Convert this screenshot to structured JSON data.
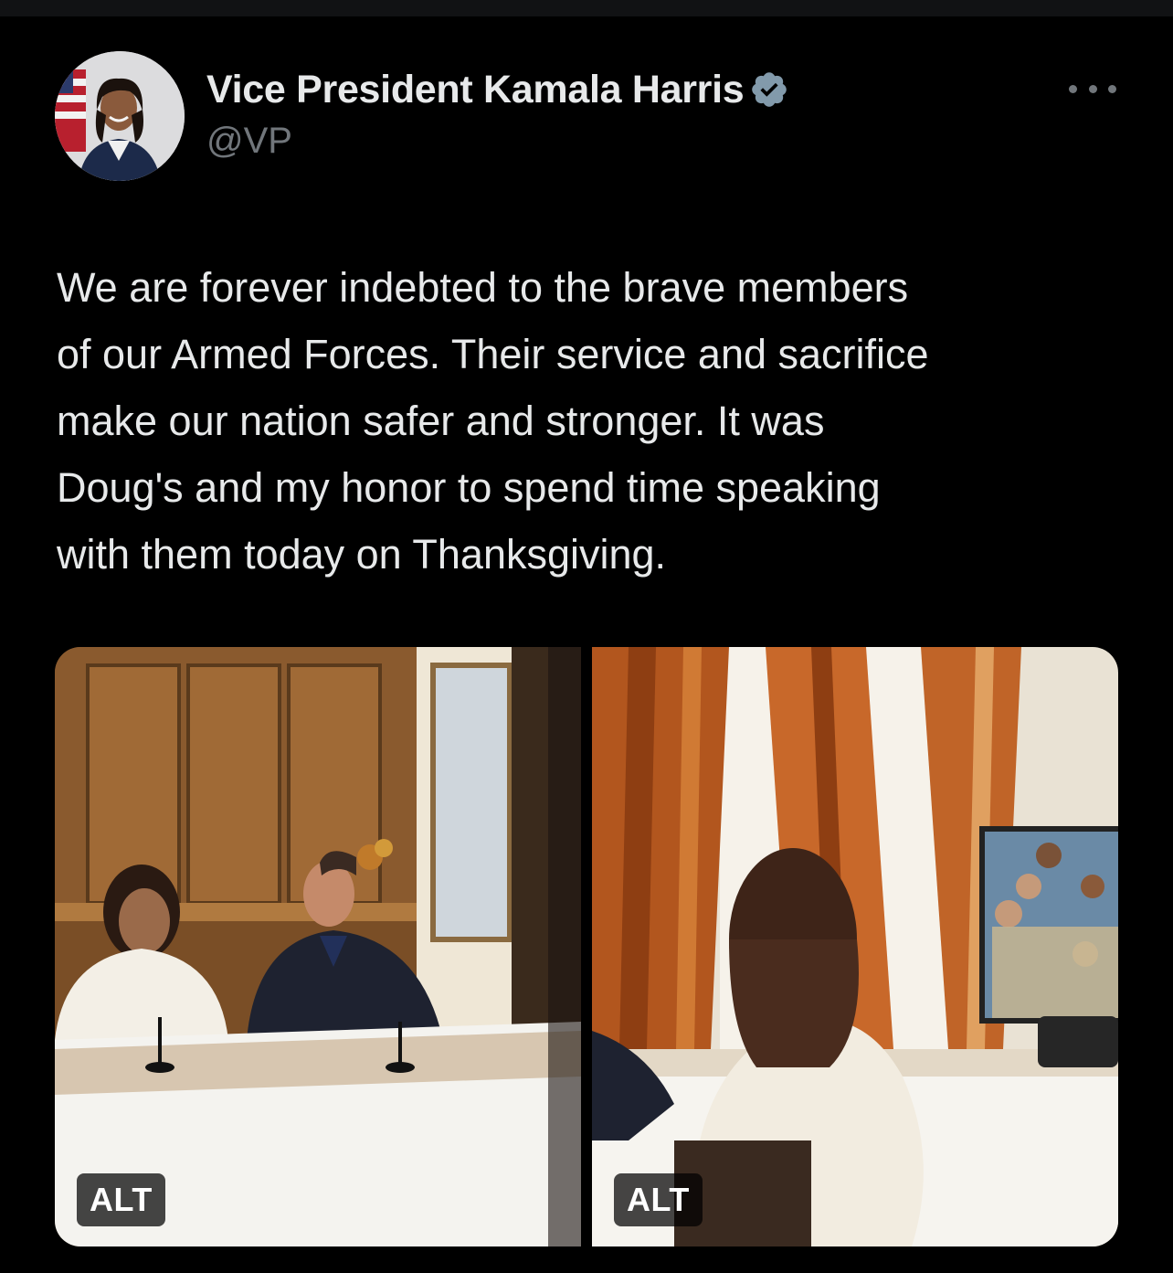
{
  "author": {
    "display_name": "Vice President Kamala Harris",
    "handle": "@VP",
    "verified_icon": "verified-badge-icon",
    "verified_color": "#829aab"
  },
  "menu": {
    "more_icon": "more-horizontal-icon"
  },
  "tweet": {
    "text_lines": [
      "We are forever indebted to the brave members",
      "of our Armed Forces. Their service and sacrifice",
      "make our nation safer and stronger. It was",
      "Doug's and my honor to spend time speaking",
      "with them today on Thanksgiving."
    ]
  },
  "media": {
    "photos": [
      {
        "alt_label": "ALT"
      },
      {
        "alt_label": "ALT"
      }
    ]
  },
  "colors": {
    "background": "#000000",
    "text_primary": "#e7e9ea",
    "text_secondary": "#71767b"
  }
}
